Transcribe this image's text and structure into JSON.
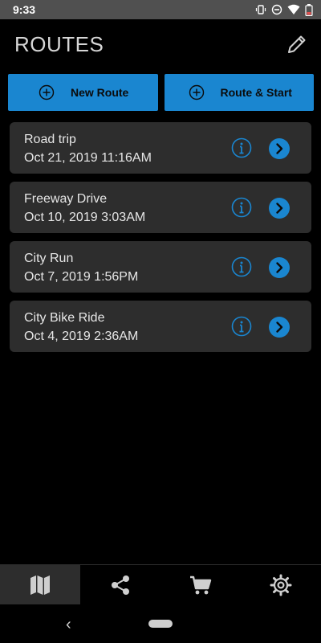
{
  "statusbar": {
    "time": "9:33"
  },
  "header": {
    "title": "ROUTES"
  },
  "actions": {
    "new_route": "New Route",
    "route_start": "Route & Start"
  },
  "routes": [
    {
      "name": "Road trip",
      "date": "Oct 21, 2019 11:16AM"
    },
    {
      "name": "Freeway Drive",
      "date": "Oct 10, 2019 3:03AM"
    },
    {
      "name": "City Run",
      "date": "Oct 7, 2019 1:56PM"
    },
    {
      "name": "City Bike Ride",
      "date": "Oct 4, 2019 2:36AM"
    }
  ],
  "colors": {
    "accent": "#1a86d0",
    "card": "#2d2d2d",
    "background": "#000000",
    "statusbar": "#505050"
  },
  "icons": {
    "header": "pencil-icon",
    "card_info": "info-icon",
    "card_go": "chevron-right-icon",
    "tabs": [
      "map-icon",
      "share-icon",
      "cart-icon",
      "gear-icon"
    ]
  }
}
